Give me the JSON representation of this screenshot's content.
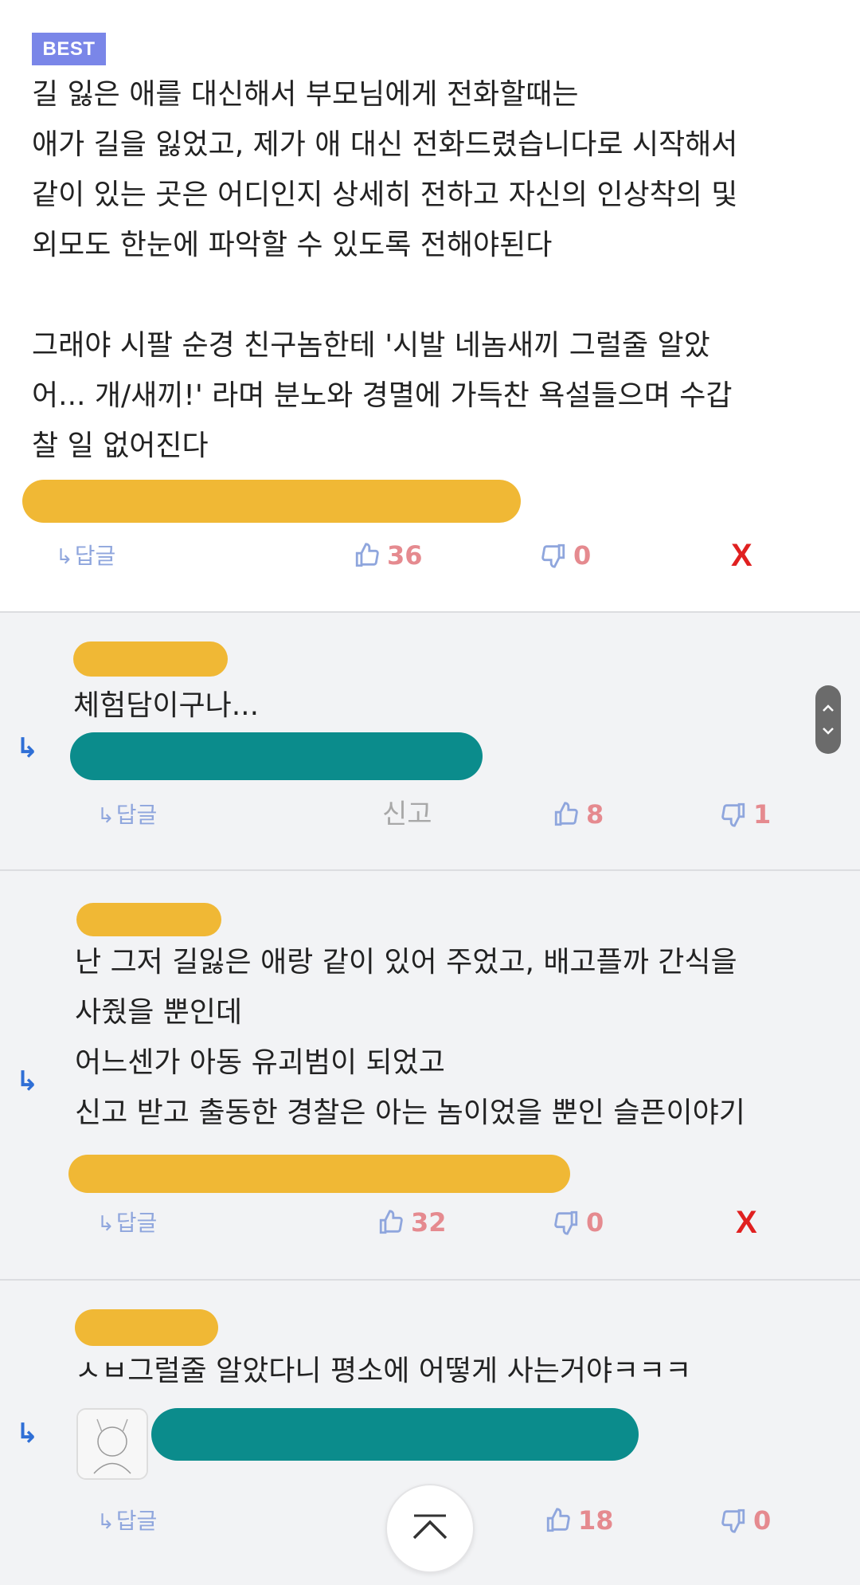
{
  "best_badge": "BEST",
  "main_comment": {
    "lines": [
      "길 잃은 애를 대신해서 부모님에게 전화할때는",
      "애가 길을 잃었고, 제가 애 대신 전화드렸습니다로 시작해서",
      "같이 있는 곳은 어디인지 상세히 전하고 자신의 인상착의 및",
      "외모도 한눈에 파악할 수 있도록 전해야된다",
      "그래야 시팔 순경 친구놈한테 '시발 네놈새끼 그럴줄 알았",
      "어... 개/새끼!' 라며 분노와 경멸에 가득찬 욕설들으며 수갑",
      "찰 일 없어진다"
    ],
    "reply_label": "답글",
    "likes": "36",
    "dislikes": "0",
    "delete_label": "X"
  },
  "replies": [
    {
      "text": [
        "체험담이구나..."
      ],
      "reply_label": "답글",
      "report_label": "신고",
      "likes": "8",
      "dislikes": "1"
    },
    {
      "text": [
        "난 그저 길잃은 애랑 같이 있어 주었고, 배고플까 간식을",
        "사줬을 뿐인데",
        "어느센가 아동 유괴범이 되었고",
        "신고 받고 출동한 경찰은 아는 놈이었을 뿐인 슬픈이야기"
      ],
      "reply_label": "답글",
      "likes": "32",
      "dislikes": "0",
      "delete_label": "X"
    },
    {
      "text": [
        "ㅅㅂ그럴줄 알았다니 평소에 어떻게 사는거야ㅋㅋㅋ"
      ],
      "reply_label": "답글",
      "likes": "18",
      "dislikes": "0"
    }
  ],
  "icons": {
    "reply_arrow": "reply-arrow-icon",
    "thumbs_up": "thumbs-up-icon",
    "thumbs_down": "thumbs-down-icon",
    "scroll_top": "chevron-up-icon"
  },
  "colors": {
    "badge": "#7a86e8",
    "vote": "#e58a8f",
    "delete": "#e02020",
    "reply_icon": "#2f6fd6",
    "reply_link": "#8fa6dd"
  }
}
